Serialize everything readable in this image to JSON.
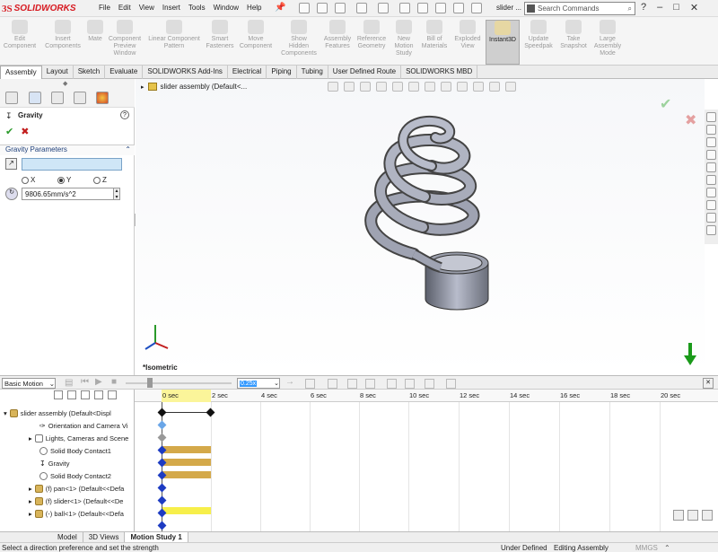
{
  "app": {
    "logo_ds": "3S",
    "logo_text": "SOLIDWORKS",
    "doc_title": "slider ..."
  },
  "menu": [
    "File",
    "Edit",
    "View",
    "Insert",
    "Tools",
    "Window",
    "Help"
  ],
  "search": {
    "placeholder": "Search Commands"
  },
  "ribbon": [
    {
      "label": "Edit\nComponent",
      "icon": "edit-component-icon"
    },
    {
      "label": "Insert\nComponents",
      "icon": "insert-components-icon"
    },
    {
      "label": "Mate",
      "icon": "mate-icon"
    },
    {
      "label": "Component\nPreview\nWindow",
      "icon": "component-preview-icon"
    },
    {
      "label": "Linear Component\nPattern",
      "icon": "linear-pattern-icon"
    },
    {
      "label": "Smart\nFasteners",
      "icon": "smart-fasteners-icon"
    },
    {
      "label": "Move\nComponent",
      "icon": "move-component-icon"
    },
    {
      "label": "Show\nHidden\nComponents",
      "icon": "show-hidden-icon"
    },
    {
      "label": "Assembly\nFeatures",
      "icon": "assembly-features-icon"
    },
    {
      "label": "Reference\nGeometry",
      "icon": "reference-geometry-icon"
    },
    {
      "label": "New\nMotion\nStudy",
      "icon": "new-motion-study-icon"
    },
    {
      "label": "Bill of\nMaterials",
      "icon": "bom-icon"
    },
    {
      "label": "Exploded\nView",
      "icon": "exploded-view-icon"
    },
    {
      "label": "Instant3D",
      "icon": "instant3d-icon",
      "active": true
    },
    {
      "label": "Update\nSpeedpak",
      "icon": "speedpak-icon"
    },
    {
      "label": "Take\nSnapshot",
      "icon": "snapshot-icon"
    },
    {
      "label": "Large\nAssembly\nMode",
      "icon": "large-assembly-icon"
    }
  ],
  "cmd_tabs": [
    "Assembly",
    "Layout",
    "Sketch",
    "Evaluate",
    "SOLIDWORKS Add-Ins",
    "Electrical",
    "Piping",
    "Tubing",
    "User Defined Route",
    "SOLIDWORKS MBD"
  ],
  "property_manager": {
    "title": "Gravity",
    "section": "Gravity Parameters",
    "directions": [
      {
        "label": "X",
        "checked": false
      },
      {
        "label": "Y",
        "checked": true
      },
      {
        "label": "Z",
        "checked": false
      }
    ],
    "gravity_value": "9806.65mm/s^2"
  },
  "viewport": {
    "tree_label": "slider assembly  (Default<...",
    "view_label": "*Isometric"
  },
  "motion": {
    "type": "Basic Motion",
    "speed": "0.25x",
    "ticks": [
      "0 sec",
      "2 sec",
      "4 sec",
      "6 sec",
      "8 sec",
      "10 sec",
      "12 sec",
      "14 sec",
      "16 sec",
      "18 sec",
      "20 sec"
    ],
    "tree": [
      {
        "label": "slider assembly  (Default<Displ",
        "icon": "assembly-icon"
      },
      {
        "label": "Orientation and Camera Vi",
        "icon": "camera-icon"
      },
      {
        "label": "Lights, Cameras and Scene",
        "icon": "lights-icon"
      },
      {
        "label": "Solid Body Contact1",
        "icon": "contact-icon"
      },
      {
        "label": "Gravity",
        "icon": "gravity-icon"
      },
      {
        "label": "Solid Body Contact2",
        "icon": "contact-icon"
      },
      {
        "label": "(f) pan<1> (Default<<Defa",
        "icon": "part-icon"
      },
      {
        "label": "(f) slider<1> (Default<<De",
        "icon": "part-icon"
      },
      {
        "label": "(-) ball<1> (Default<<Defa",
        "icon": "part-icon"
      }
    ]
  },
  "bottom_tabs": [
    "Model",
    "3D Views",
    "Motion Study 1"
  ],
  "status": {
    "hint": "Select a direction preference and set the strength",
    "state1": "Under Defined",
    "state2": "Editing Assembly",
    "units": "MMGS"
  },
  "colors": {
    "brand": "#d71920",
    "gravity_arrow": "#1a9a1a",
    "keyframe": "#1d3bc2",
    "bar_gold": "#d4a94a",
    "bar_yellow": "#f7ef4a"
  }
}
